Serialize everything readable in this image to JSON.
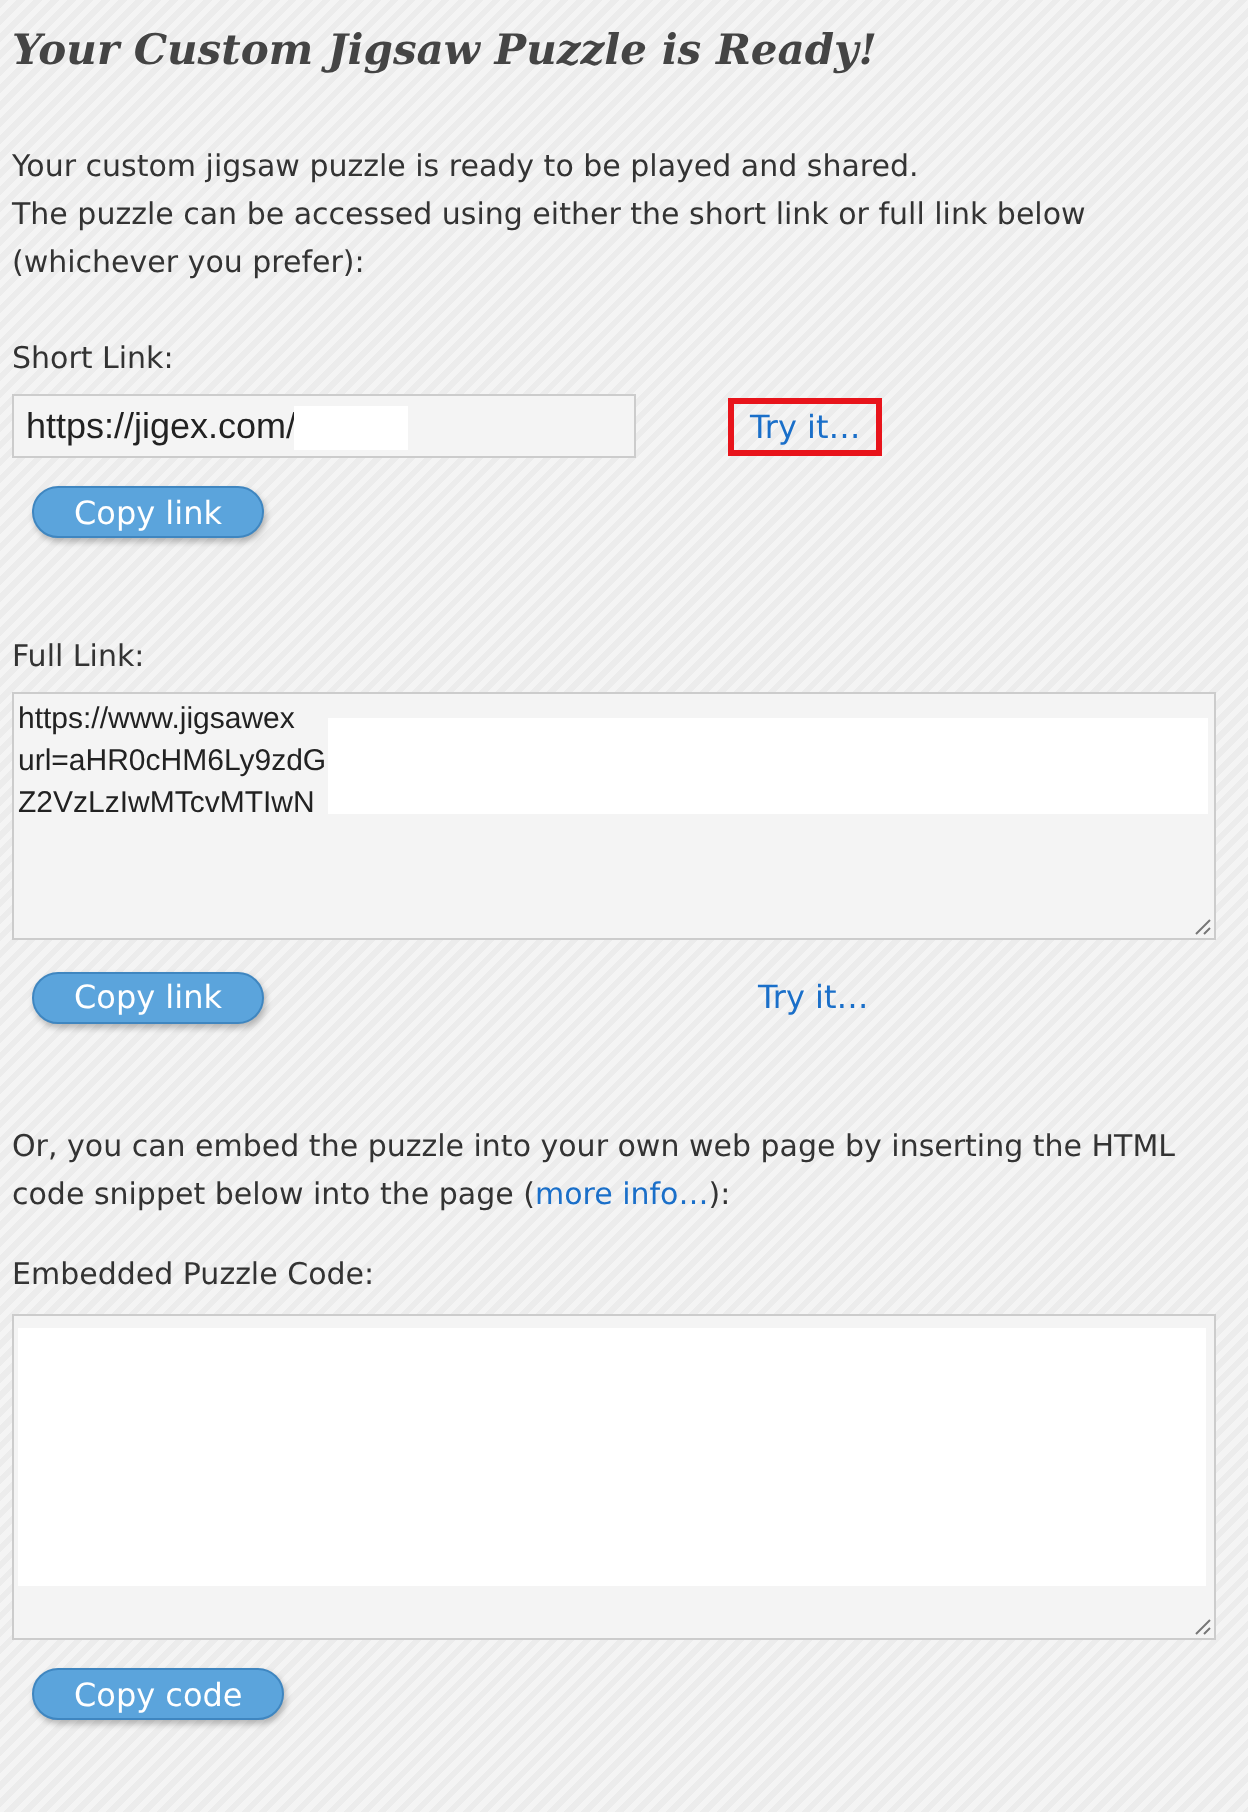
{
  "title": "Your Custom Jigsaw Puzzle is Ready!",
  "intro": [
    "Your custom jigsaw puzzle is ready to be played and shared.",
    "The puzzle can be accessed using either the short link or full link below (whichever you prefer):"
  ],
  "short_link": {
    "label": "Short Link:",
    "value": "https://jigex.com/",
    "button": "Copy link",
    "try_link": {
      "text": "Try it…",
      "highlighted": true
    }
  },
  "full_link": {
    "label": "Full Link:",
    "lines": [
      "https://www.jigsawex",
      "url=aHR0cHM6Ly9zdG",
      "Z2VzLzIwMTcvMTIwN"
    ],
    "button": "Copy link",
    "try_link": {
      "text": "Try it…",
      "highlighted": false
    }
  },
  "embed_text": {
    "before": "Or, you can embed the puzzle into your own web page by inserting the HTML code snippet below into the page (",
    "link": "more info…",
    "after": "):"
  },
  "embedded_code": {
    "label": "Embedded Puzzle Code:",
    "button": "Copy code"
  }
}
